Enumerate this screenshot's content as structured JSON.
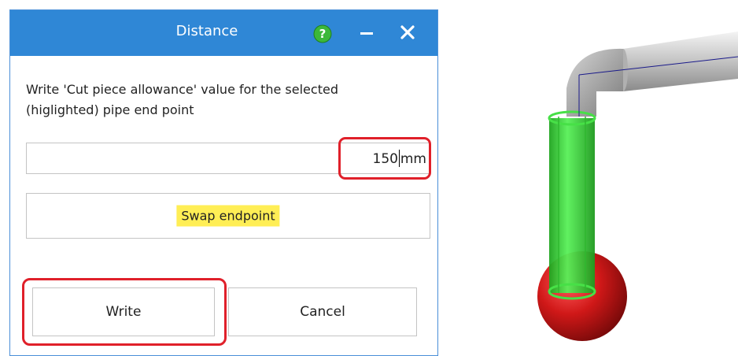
{
  "dialog": {
    "title": "Distance",
    "instruction_line1": "Write 'Cut piece allowance' value for the selected",
    "instruction_line2": "(higlighted) pipe end point",
    "value": "150",
    "unit": "mm",
    "swap_label": "Swap endpoint",
    "write_label": "Write",
    "cancel_label": "Cancel"
  },
  "icons": {
    "help": "question-mark-icon",
    "minimize": "minimize-icon",
    "close": "close-icon"
  },
  "colors": {
    "titlebar": "#2f87d6",
    "highlight_border": "#e0202a",
    "swap_highlight": "#ffee55",
    "pipe_selected": "#2fd82f",
    "endpoint_sphere": "#cc1a1a",
    "pipe_grey": "#a8a8a8"
  }
}
